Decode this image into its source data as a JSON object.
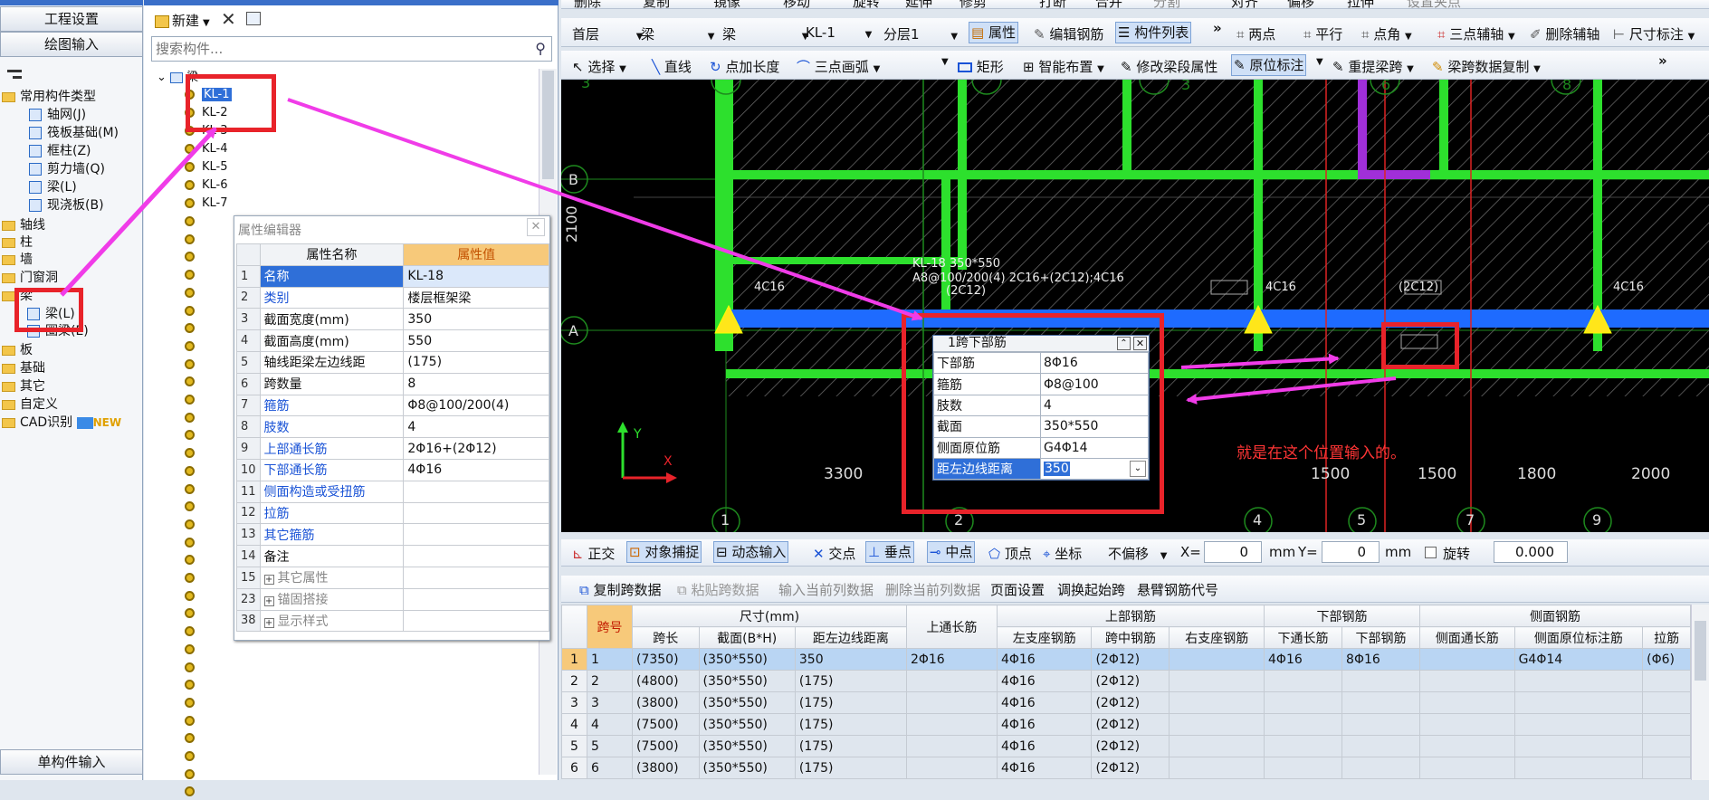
{
  "nav": {
    "project_settings": "工程设置",
    "drawing_input": "绘图输入",
    "single_component_input": "单构件输入",
    "tree": [
      {
        "label": "常用构件类型"
      },
      {
        "label": "轴网(J)"
      },
      {
        "label": "筏板基础(M)"
      },
      {
        "label": "框柱(Z)"
      },
      {
        "label": "剪力墙(Q)"
      },
      {
        "label": "梁(L)"
      },
      {
        "label": "现浇板(B)"
      },
      {
        "label": "轴线"
      },
      {
        "label": "柱"
      },
      {
        "label": "墙"
      },
      {
        "label": "门窗洞"
      },
      {
        "label": "梁"
      },
      {
        "label": "梁(L)"
      },
      {
        "label": "圈梁(E)"
      },
      {
        "label": "板"
      },
      {
        "label": "基础"
      },
      {
        "label": "其它"
      },
      {
        "label": "自定义"
      },
      {
        "label": "CAD识别"
      }
    ],
    "new_badge": "NEW"
  },
  "comp_list": {
    "new_label": "新建",
    "search_placeholder": "搜索构件...",
    "root_label": "梁",
    "items": [
      "KL-1",
      "KL-2",
      "KL-3",
      "KL-4",
      "KL-5",
      "KL-6",
      "KL-7"
    ]
  },
  "prop_editor": {
    "title": "属性编辑器",
    "col_name": "属性名称",
    "col_value": "属性值",
    "rows": [
      {
        "num": "1",
        "name": "名称",
        "value": "KL-18"
      },
      {
        "num": "2",
        "name": "类别",
        "value": "楼层框架梁"
      },
      {
        "num": "3",
        "name": "截面宽度(mm)",
        "value": "350"
      },
      {
        "num": "4",
        "name": "截面高度(mm)",
        "value": "550"
      },
      {
        "num": "5",
        "name": "轴线距梁左边线距",
        "value": "(175)"
      },
      {
        "num": "6",
        "name": "跨数量",
        "value": "8"
      },
      {
        "num": "7",
        "name": "箍筋",
        "value": "Φ8@100/200(4)"
      },
      {
        "num": "8",
        "name": "肢数",
        "value": "4"
      },
      {
        "num": "9",
        "name": "上部通长筋",
        "value": "2Φ16+(2Φ12)"
      },
      {
        "num": "10",
        "name": "下部通长筋",
        "value": "4Φ16"
      },
      {
        "num": "11",
        "name": "侧面构造或受扭筋",
        "value": ""
      },
      {
        "num": "12",
        "name": "拉筋",
        "value": ""
      },
      {
        "num": "13",
        "name": "其它箍筋",
        "value": ""
      },
      {
        "num": "14",
        "name": "备注",
        "value": ""
      },
      {
        "num": "15",
        "name": "其它属性",
        "value": ""
      },
      {
        "num": "23",
        "name": "锚固搭接",
        "value": ""
      },
      {
        "num": "38",
        "name": "显示样式",
        "value": ""
      }
    ]
  },
  "toolbar1": {
    "delete": "删除",
    "copy": "复制",
    "mirror": "镜像",
    "move": "移动",
    "rotate": "旋转",
    "extend": "延伸",
    "trim": "修剪",
    "break": "打断",
    "merge": "合并",
    "split": "分割",
    "align": "对齐",
    "offset": "偏移",
    "stretch": "拉伸",
    "set_point": "设置夹点"
  },
  "toolbar2": {
    "floor": "首层",
    "type1": "梁",
    "type2": "梁",
    "comp": "KL-1",
    "layer": "分层1",
    "props": "属性",
    "edit_rebar": "编辑钢筋",
    "comp_list": "构件列表",
    "two_point": "两点",
    "parallel": "平行",
    "point_angle": "点角",
    "three_point_aux": "三点辅轴",
    "del_aux": "删除辅轴",
    "dim": "尺寸标注"
  },
  "toolbar3": {
    "select": "选择",
    "line": "直线",
    "point_len": "点加长度",
    "three_arc": "三点画弧",
    "rect": "矩形",
    "smart": "智能布置",
    "modify_seg": "修改梁段属性",
    "orig_mark": "原位标注",
    "reextract": "重提梁跨",
    "span_copy": "梁跨数据复制"
  },
  "cad": {
    "axes_top": [
      "3",
      "6",
      "8"
    ],
    "axes_left": [
      "B",
      "A"
    ],
    "dim_2100": "2100",
    "axes_bottom": [
      "1",
      "2",
      "4",
      "5",
      "7",
      "9"
    ],
    "dims_bottom": [
      "3300",
      "1500",
      "1500",
      "1800",
      "2000"
    ],
    "beam_label1": "KL-18 350*550",
    "beam_label2": "A8@100/200(4) 2C16+(2C12);4C16",
    "beam_label3": "(2C12)",
    "rebar_4c16": "4C16",
    "rebar_2c12": "(2C12)",
    "annotation": "就是在这个位置输入的。",
    "y_label": "Y",
    "x_label": "X"
  },
  "popup": {
    "title": "1跨下部筋",
    "rows": [
      {
        "name": "下部筋",
        "value": "8Φ16"
      },
      {
        "name": "箍筋",
        "value": "Φ8@100"
      },
      {
        "name": "肢数",
        "value": "4"
      },
      {
        "name": "截面",
        "value": "350*550"
      },
      {
        "name": "侧面原位筋",
        "value": "G4Φ14"
      },
      {
        "name": "距左边线距离",
        "value": "350"
      }
    ]
  },
  "snapbar": {
    "ortho": "正交",
    "obj_snap": "对象捕捉",
    "dyn_input": "动态输入",
    "intersect": "交点",
    "perp": "垂点",
    "mid": "中点",
    "vertex": "顶点",
    "coord": "坐标",
    "no_offset": "不偏移",
    "x_label": "X=",
    "x_val": "0",
    "mm": "mm",
    "y_label": "Y=",
    "y_val": "0",
    "mm2": "mm",
    "rotate": "旋转",
    "rot_val": "0.000"
  },
  "gridbar": {
    "copy_span": "复制跨数据",
    "paste_span": "粘贴跨数据",
    "input_col": "输入当前列数据",
    "del_col": "删除当前列数据",
    "page_setup": "页面设置",
    "adjust_start": "调换起始跨",
    "cantilever": "悬臂钢筋代号"
  },
  "grid": {
    "h_span": "跨号",
    "h_size": "尺寸(mm)",
    "h_top_through": "上通长筋",
    "h_top": "上部钢筋",
    "h_bottom": "下部钢筋",
    "h_side": "侧面钢筋",
    "sub": [
      "跨长",
      "截面(B*H)",
      "距左边线距离",
      "左支座钢筋",
      "跨中钢筋",
      "右支座钢筋",
      "下通长筋",
      "下部钢筋",
      "侧面通长筋",
      "侧面原位标注筋",
      "拉筋"
    ],
    "rows": [
      {
        "n": "1",
        "span": "1",
        "len": "(7350)",
        "sec": "(350*550)",
        "dist": "350",
        "top": "2Φ16",
        "left": "4Φ16",
        "mid": "(2Φ12)",
        "right": "",
        "bthru": "4Φ16",
        "bot": "8Φ16",
        "sthru": "",
        "sorig": "G4Φ14",
        "tie": "(Φ6)"
      },
      {
        "n": "2",
        "span": "2",
        "len": "(4800)",
        "sec": "(350*550)",
        "dist": "(175)",
        "top": "",
        "left": "4Φ16",
        "mid": "(2Φ12)",
        "right": "",
        "bthru": "",
        "bot": "",
        "sthru": "",
        "sorig": "",
        "tie": ""
      },
      {
        "n": "3",
        "span": "3",
        "len": "(3800)",
        "sec": "(350*550)",
        "dist": "(175)",
        "top": "",
        "left": "4Φ16",
        "mid": "(2Φ12)",
        "right": "",
        "bthru": "",
        "bot": "",
        "sthru": "",
        "sorig": "",
        "tie": ""
      },
      {
        "n": "4",
        "span": "4",
        "len": "(7500)",
        "sec": "(350*550)",
        "dist": "(175)",
        "top": "",
        "left": "4Φ16",
        "mid": "(2Φ12)",
        "right": "",
        "bthru": "",
        "bot": "",
        "sthru": "",
        "sorig": "",
        "tie": ""
      },
      {
        "n": "5",
        "span": "5",
        "len": "(7500)",
        "sec": "(350*550)",
        "dist": "(175)",
        "top": "",
        "left": "4Φ16",
        "mid": "(2Φ12)",
        "right": "",
        "bthru": "",
        "bot": "",
        "sthru": "",
        "sorig": "",
        "tie": ""
      },
      {
        "n": "6",
        "span": "6",
        "len": "(3800)",
        "sec": "(350*550)",
        "dist": "(175)",
        "top": "",
        "left": "4Φ16",
        "mid": "(2Φ12)",
        "right": "",
        "bthru": "",
        "bot": "",
        "sthru": "",
        "sorig": "",
        "tie": ""
      }
    ]
  },
  "colors": {
    "highlight_red": "#e8232a",
    "arrow_magenta": "#f03ce8",
    "beam_blue": "#1e6bff",
    "wall_green": "#2de02d"
  }
}
